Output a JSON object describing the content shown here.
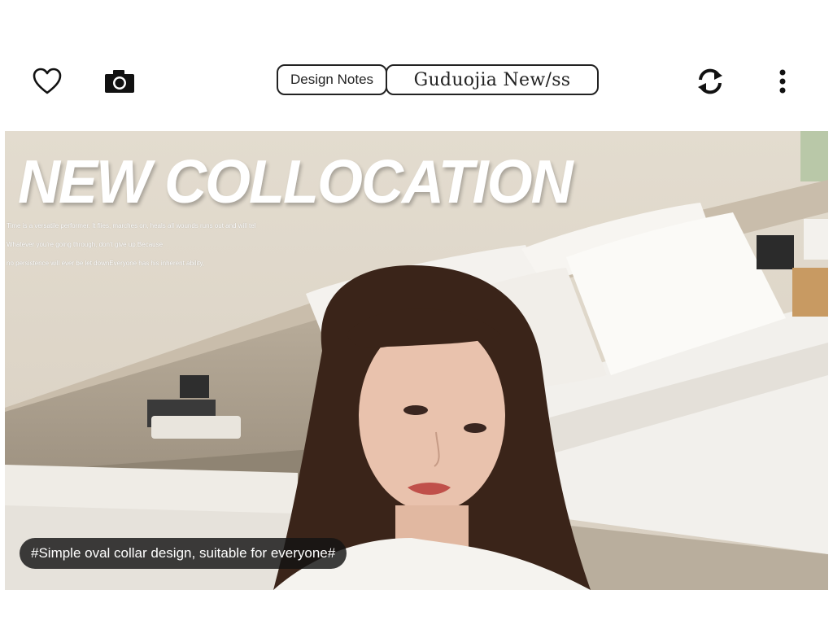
{
  "toolbar": {
    "icons": {
      "favorite": "heart-icon",
      "camera": "camera-icon",
      "refresh": "refresh-icon",
      "more": "more-vertical-icon"
    },
    "tabs": [
      {
        "label": "Design Notes"
      },
      {
        "label": "Guduojia New/ss"
      }
    ]
  },
  "banner": {
    "headline": "NEW COLLOCATION",
    "taglines": [
      "Time is a versatile performer. It flies, marches on, heals all wounds runs out and will tel",
      "Whatever you're going through, don't give up.Because",
      "no persistence will ever be let downEveryone has his inherent ability,"
    ],
    "caption": "#Simple oval collar design, suitable for everyone#"
  },
  "colors": {
    "border": "#222222",
    "caption_bg": "#141414",
    "headline": "#ffffff"
  }
}
